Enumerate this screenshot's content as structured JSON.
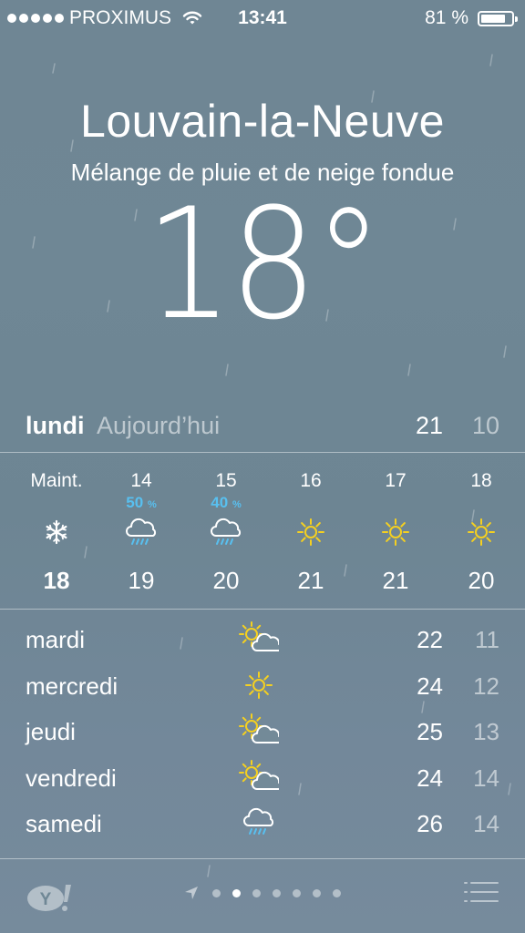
{
  "status_bar": {
    "carrier": "PROXIMUS",
    "time": "13:41",
    "battery": "81 %",
    "battery_level": 0.81
  },
  "location": {
    "city": "Louvain-la-Neuve",
    "condition": "Mélange de pluie et de neige fondue",
    "temperature": "18°"
  },
  "today": {
    "day": "lundi",
    "label": "Aujourd’hui",
    "high": "21",
    "low": "10"
  },
  "hourly": [
    {
      "time": "Maint.",
      "precip": "",
      "icon": "snowflake-icon",
      "temp": "18"
    },
    {
      "time": "14",
      "precip": "50",
      "precip_unit": "%",
      "icon": "rain-cloud-icon",
      "temp": "19"
    },
    {
      "time": "15",
      "precip": "40",
      "precip_unit": "%",
      "icon": "rain-cloud-icon",
      "temp": "20"
    },
    {
      "time": "16",
      "precip": "",
      "icon": "sun-icon",
      "temp": "21"
    },
    {
      "time": "17",
      "precip": "",
      "icon": "sun-icon",
      "temp": "21"
    },
    {
      "time": "18",
      "precip": "",
      "icon": "sun-icon",
      "temp": "20"
    }
  ],
  "daily": [
    {
      "day": "mardi",
      "icon": "partly-cloudy-icon",
      "high": "22",
      "low": "11"
    },
    {
      "day": "mercredi",
      "icon": "sun-icon",
      "high": "24",
      "low": "12"
    },
    {
      "day": "jeudi",
      "icon": "partly-cloudy-icon",
      "high": "25",
      "low": "13"
    },
    {
      "day": "vendredi",
      "icon": "partly-cloudy-icon",
      "high": "24",
      "low": "14"
    },
    {
      "day": "samedi",
      "icon": "rain-cloud-icon",
      "high": "26",
      "low": "14"
    }
  ],
  "pager": {
    "total_pages": 7,
    "current_page": 2
  },
  "colors": {
    "precip_blue": "#58c0f0",
    "sun_yellow": "#f5d020",
    "rain_blue": "#58c0f0"
  }
}
